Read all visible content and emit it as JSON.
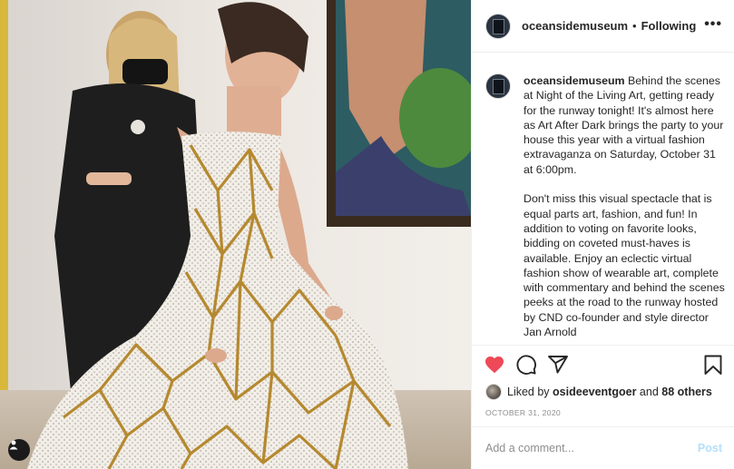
{
  "post": {
    "account": "oceansidemuseum",
    "follow_separator": "•",
    "follow_status": "Following",
    "more_label": "•••",
    "caption_username": "oceansidemuseum",
    "caption_text": " Behind the scenes at Night of the Living Art, getting ready for the runway tonight! It's almost here as Art After Dark brings the party to your house this year with a virtual fashion extravaganza on Saturday, October 31 at 6:00pm.\n\nDon't miss this visual spectacle that is equal parts art, fashion, and fun! In addition to voting on favorite looks, bidding on coveted must-haves is available. Enjoy an eclectic virtual fashion show of wearable art, complete with commentary and behind the scenes peeks at the road to the runway hosted by CND co-founder and style director Jan Arnold",
    "likes_prefix": "Liked by ",
    "likes_user": "osideeventgoer",
    "likes_middle": " and ",
    "likes_count": "88 others",
    "date": "OCTOBER 31, 2020"
  },
  "comment": {
    "placeholder": "Add a comment...",
    "post_label": "Post"
  },
  "icons": {
    "like": "heart-icon",
    "comment": "comment-icon",
    "share": "share-icon",
    "save": "bookmark-icon",
    "tags": "user-tag-icon"
  },
  "colors": {
    "liked": "#ed4956",
    "post_disabled": "#b2dffc",
    "muted": "#8e8e8e"
  }
}
